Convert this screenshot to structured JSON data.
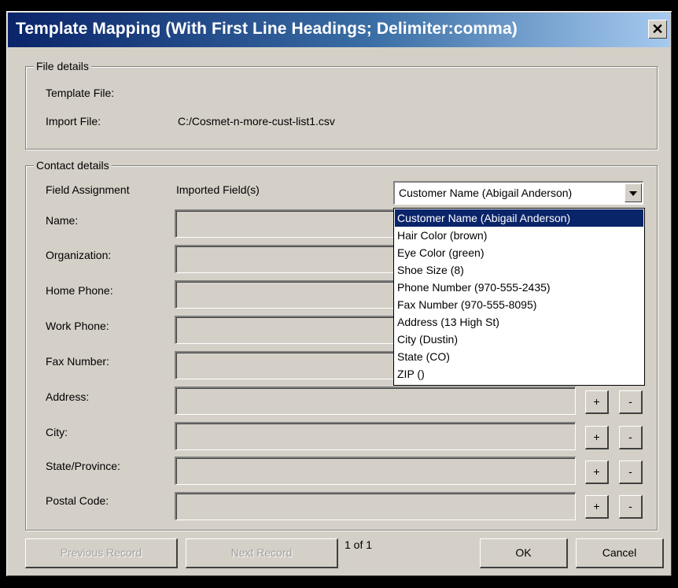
{
  "window": {
    "title": "Template Mapping (With First Line Headings; Delimiter:comma)",
    "close_label": "✕"
  },
  "file_details": {
    "legend": "File details",
    "template_label": "Template File:",
    "template_value": "",
    "import_label": "Import File:",
    "import_value": "C:/Cosmet-n-more-cust-list1.csv"
  },
  "contact_details": {
    "legend": "Contact details",
    "col_assignment": "Field Assignment",
    "col_imported": "Imported Field(s)",
    "fields": [
      {
        "label": "Name:"
      },
      {
        "label": "Organization:"
      },
      {
        "label": "Home Phone:"
      },
      {
        "label": "Work Phone:"
      },
      {
        "label": "Fax Number:"
      },
      {
        "label": "Address:"
      },
      {
        "label": "City:"
      },
      {
        "label": "State/Province:"
      },
      {
        "label": "Postal Code:"
      }
    ],
    "plus_label": "+",
    "minus_label": "-"
  },
  "combo": {
    "selected": "Customer Name (Abigail Anderson)",
    "options": [
      "Customer Name (Abigail Anderson)",
      "Hair Color (brown)",
      "Eye Color (green)",
      "Shoe Size (8)",
      "Phone Number (970-555-2435)",
      "Fax Number (970-555-8095)",
      "Address (13 High St)",
      "City (Dustin)",
      "State (CO)",
      "ZIP ()"
    ],
    "highlighted_index": 0
  },
  "footer": {
    "prev_label": "Previous Record",
    "next_label": "Next Record",
    "record_counter": "1 of 1",
    "ok_label": "OK",
    "cancel_label": "Cancel"
  }
}
